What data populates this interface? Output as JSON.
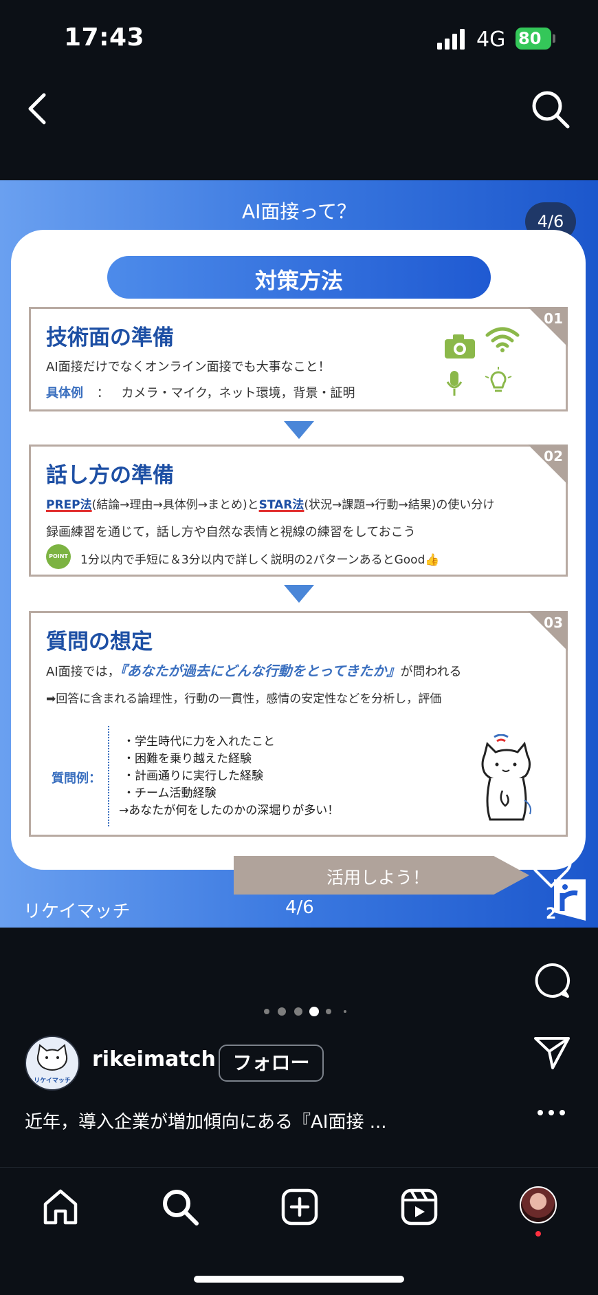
{
  "status_bar": {
    "time": "17:43",
    "network": "4G",
    "battery": "80"
  },
  "post": {
    "heading": "AI面接って？",
    "counter": "4/6",
    "section_title": "対策方法",
    "boxes": [
      {
        "num": "01",
        "title": "技術面の準備",
        "line1": "AI面接だけでなくオンライン面接でも大事なこと！",
        "example_label": "具体例",
        "example_sep": "：",
        "example_text": "カメラ・マイク，ネット環境，背景・証明"
      },
      {
        "num": "02",
        "title": "話し方の準備",
        "prep": "PREP法",
        "prep_detail": "(結論→理由→具体例→まとめ)と",
        "star": "STAR法",
        "star_detail": "(状況→課題→行動→結果)の使い分け",
        "line2": "録画練習を通じて，話し方や自然な表情と視線の練習をしておこう",
        "point_badge": "POINT",
        "point_text": "1分以内で手短に＆3分以内で詳しく説明の2パターンあるとGood👍"
      },
      {
        "num": "03",
        "title": "質問の想定",
        "line1_pre": "AI面接では，",
        "line1_quote": "『あなたが過去にどんな行動をとってきたか』",
        "line1_post": "が問われる",
        "line2": "➡回答に含まれる論理性，行動の一貫性，感情の安定性などを分析し，評価",
        "q_label": "質問例：",
        "q_items": [
          "・学生時代に力を入れたこと",
          "・困難を乗り越えた経験",
          "・計画通りに実行した経験",
          "・チーム活動経験",
          "→あなたが何をしたのかの深堀りが多い！"
        ]
      }
    ],
    "use_tab": "活用しよう！",
    "brand": "リケイマッチ",
    "bottom_counter": "4/6"
  },
  "actions": {
    "like_count": "2"
  },
  "carousel": {
    "total": 6,
    "active": 4
  },
  "author": {
    "username": "rikeimatch",
    "follow_label": "フォロー",
    "avatar_text": "リケイマッチ"
  },
  "caption": "近年，導入企業が増加傾向にある『AI面接 ...",
  "colors": {
    "accent_blue": "#1d4fa4",
    "tan": "#b0a39b",
    "battery_green": "#34c759"
  }
}
